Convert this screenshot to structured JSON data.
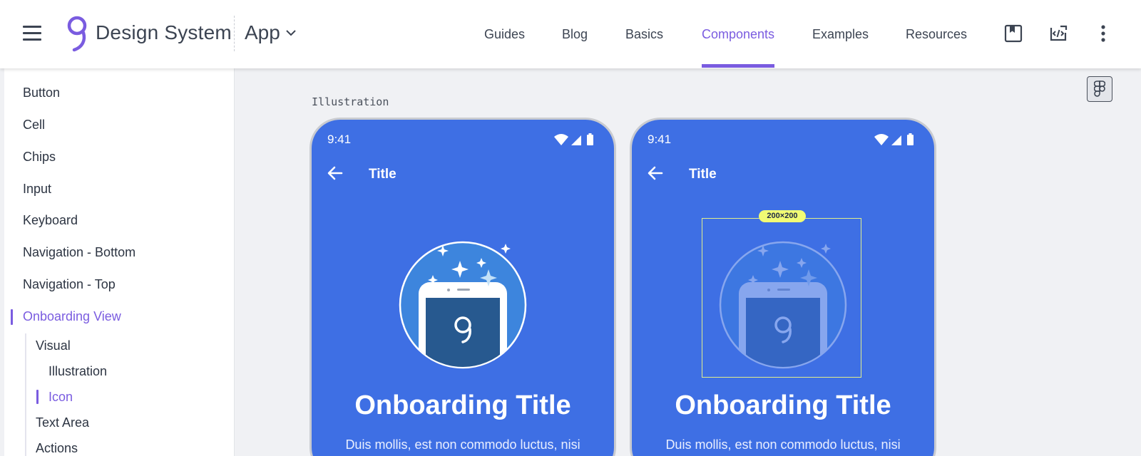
{
  "header": {
    "brand": "Design System",
    "app_switcher": "App",
    "nav": [
      {
        "label": "Guides"
      },
      {
        "label": "Blog"
      },
      {
        "label": "Basics"
      },
      {
        "label": "Components",
        "active": true
      },
      {
        "label": "Examples"
      },
      {
        "label": "Resources"
      }
    ],
    "icons": [
      "bookmark-icon",
      "code-icon",
      "more-vert-icon"
    ]
  },
  "sidebar": {
    "items": [
      {
        "label": "Button"
      },
      {
        "label": "Cell"
      },
      {
        "label": "Chips"
      },
      {
        "label": "Input"
      },
      {
        "label": "Keyboard"
      },
      {
        "label": "Navigation - Bottom"
      },
      {
        "label": "Navigation - Top"
      },
      {
        "label": "Onboarding View",
        "active": true
      }
    ],
    "sub_items": [
      {
        "label": "Visual"
      },
      {
        "label": "Illustration"
      },
      {
        "label": "Icon",
        "active": true
      },
      {
        "label": "Text Area"
      },
      {
        "label": "Actions"
      }
    ]
  },
  "main": {
    "section_label": "Illustration",
    "figma_icon": "figma-icon",
    "phones": [
      {
        "time": "9:41",
        "title": "Title",
        "onboarding_title": "Onboarding Title",
        "body": "Duis mollis, est non commodo luctus, nisi"
      },
      {
        "time": "9:41",
        "title": "Title",
        "size_badge": "200×200",
        "onboarding_title": "Onboarding Title",
        "body": "Duis mollis, est non commodo luctus, nisi"
      }
    ]
  },
  "colors": {
    "accent": "#7a5ce0",
    "phone_bg": "#3e6fe4",
    "spec_highlight": "#f1fb74"
  }
}
